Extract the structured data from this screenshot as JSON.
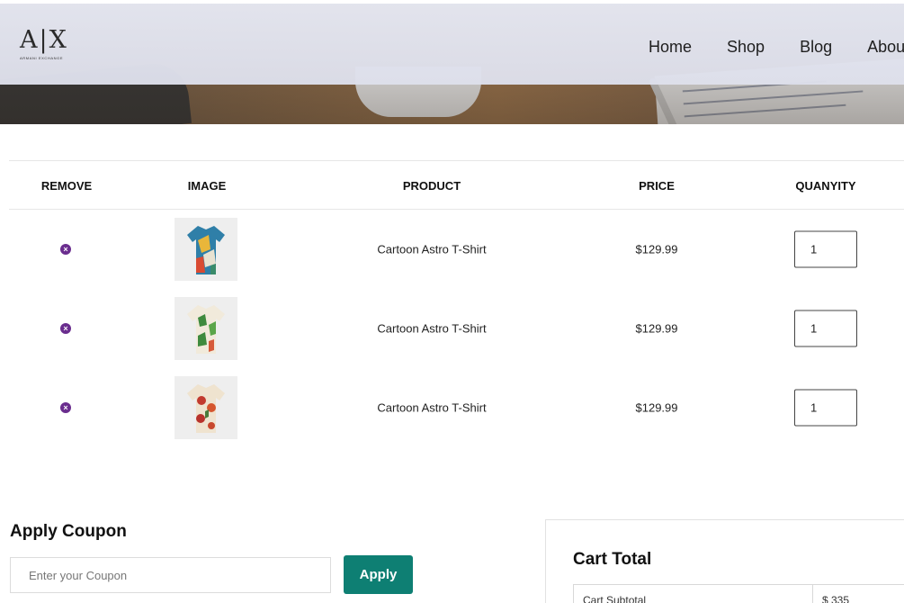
{
  "header": {
    "logo_mark": "A|X",
    "logo_sub": "ARMANI EXCHANGE",
    "nav": [
      "Home",
      "Shop",
      "Blog",
      "About"
    ]
  },
  "cart": {
    "columns": [
      "REMOVE",
      "IMAGE",
      "PRODUCT",
      "PRICE",
      "QUANYITY"
    ],
    "rows": [
      {
        "product": "Cartoon Astro T-Shirt",
        "price": "$129.99",
        "quantity": "1",
        "image": "shirt-thumbnail-1"
      },
      {
        "product": "Cartoon Astro T-Shirt",
        "price": "$129.99",
        "quantity": "1",
        "image": "shirt-thumbnail-2"
      },
      {
        "product": "Cartoon Astro T-Shirt",
        "price": "$129.99",
        "quantity": "1",
        "image": "shirt-thumbnail-3"
      }
    ],
    "remove_icon": "close-circle-icon"
  },
  "coupon": {
    "title": "Apply Coupon",
    "placeholder": "Enter your Coupon",
    "button": "Apply"
  },
  "total": {
    "title": "Cart Total",
    "subtotal_label": "Cart Subtotal",
    "subtotal_value": "$ 335"
  },
  "colors": {
    "accent": "#0e7f73",
    "remove": "#6a2d8e"
  }
}
